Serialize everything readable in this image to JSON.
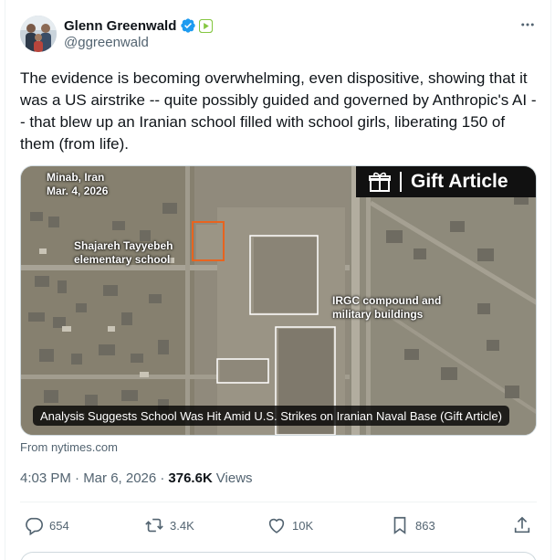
{
  "author": {
    "display_name": "Glenn Greenwald",
    "handle": "@ggreenwald",
    "verified_badge_icon": "verified-badge-icon",
    "subscription_icon": "rumble-icon"
  },
  "more_icon": "more-horizontal-icon",
  "tweet": {
    "text": "The evidence is becoming overwhelming, even dispositive, showing that it was a US airstrike -- quite possibly guided and governed by Anthropic's AI -- that blew up an Iranian school filled with school girls, liberating 150 of them (from life)."
  },
  "media": {
    "gift_label": "Gift Article",
    "gift_icon": "gift-icon",
    "location": "Minab, Iran",
    "date": "Mar. 4, 2026",
    "school_label_line1": "Shajareh Tayyebeh",
    "school_label_line2": "elementary school",
    "irgc_label_line1": "IRGC compound and",
    "irgc_label_line2": "military buildings",
    "headline": "Analysis Suggests School Was Hit Amid U.S. Strikes on Iranian Naval Base (Gift Article)"
  },
  "source": {
    "text": "From nytimes.com"
  },
  "meta": {
    "timestamp": "4:03 PM · Mar 6, 2026 ·",
    "views_count": "376.6K",
    "views_label": "Views"
  },
  "actions": {
    "replies": "654",
    "reposts": "3.4K",
    "likes": "10K",
    "bookmarks": "863"
  },
  "colors": {
    "text_primary": "#0f1419",
    "text_secondary": "#536471",
    "verified_blue": "#1d9bf0",
    "rumble_green": "#85c742",
    "highlight_orange": "#e8641f"
  }
}
